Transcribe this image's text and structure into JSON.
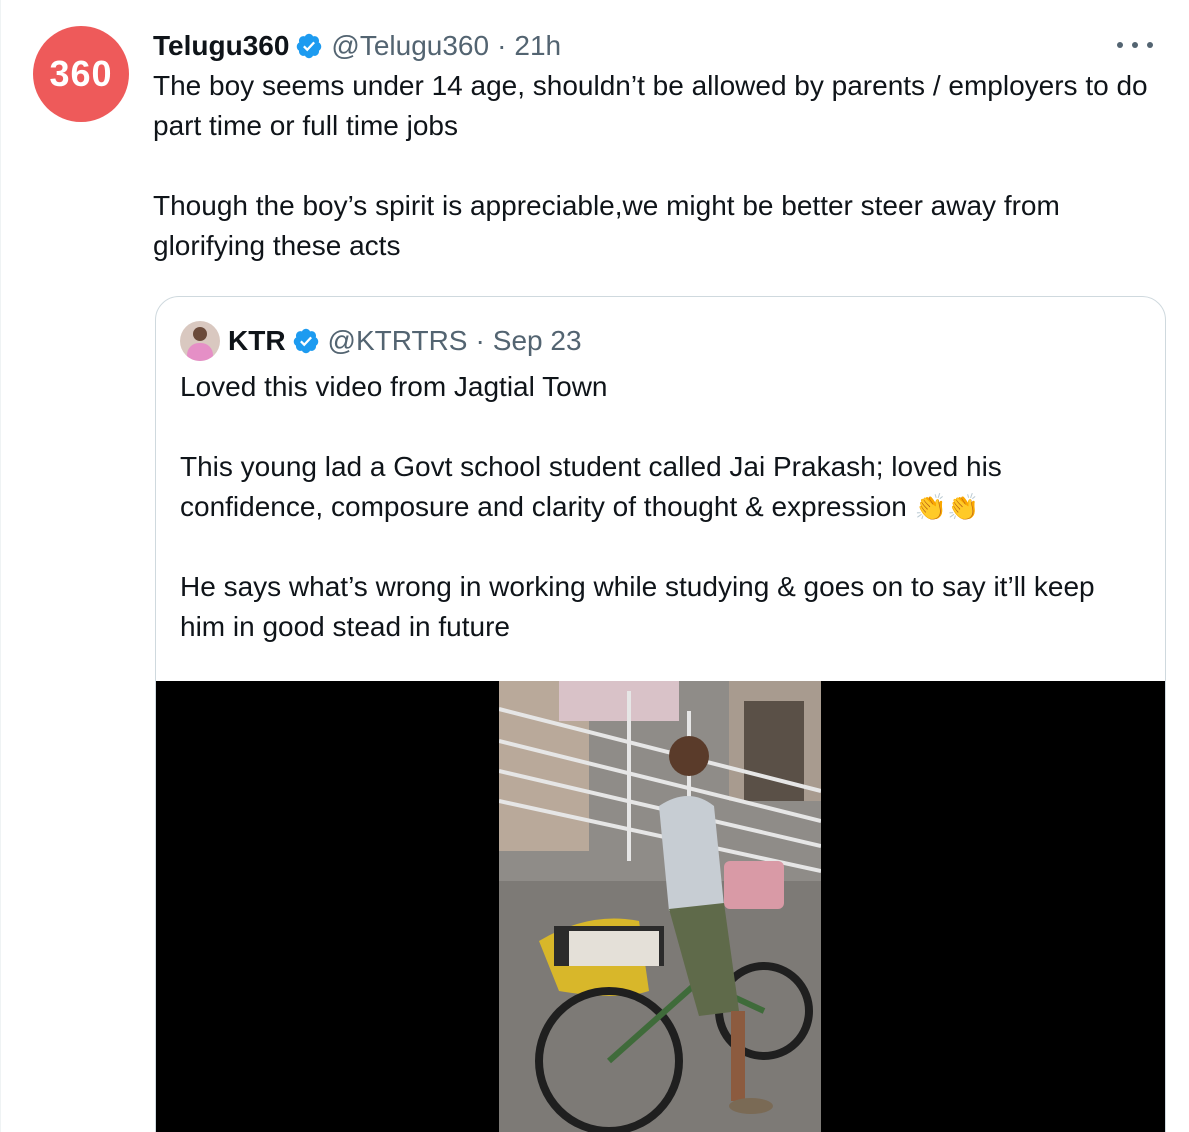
{
  "tweet": {
    "avatar_text": "360",
    "display_name": "Telugu360",
    "handle": "@Telugu360",
    "separator": "·",
    "time": "21h",
    "paragraphs": [
      "The boy seems under 14 age, shouldn’t be allowed by parents / employers to do part time or full time jobs",
      "Though the boy’s spirit is appreciable,we might be better steer away from glorifying these acts"
    ]
  },
  "quote": {
    "display_name": "KTR",
    "handle": "@KTRTRS",
    "separator": "·",
    "date": "Sep 23",
    "paragraphs": [
      "Loved this video from Jagtial Town",
      "This young lad a Govt school student called Jai Prakash; loved his confidence, composure and clarity of thought & expression",
      "He says what’s wrong in working while studying & goes on to say it’ll keep him in good stead in future"
    ],
    "emoji": "👏👏"
  },
  "colors": {
    "avatar_bg": "#ee5a5a",
    "verified": "#1d9bf0",
    "secondary_text": "#536471",
    "border": "#cfd9de"
  },
  "icons": [
    "verified-badge-icon",
    "more-options-icon"
  ]
}
